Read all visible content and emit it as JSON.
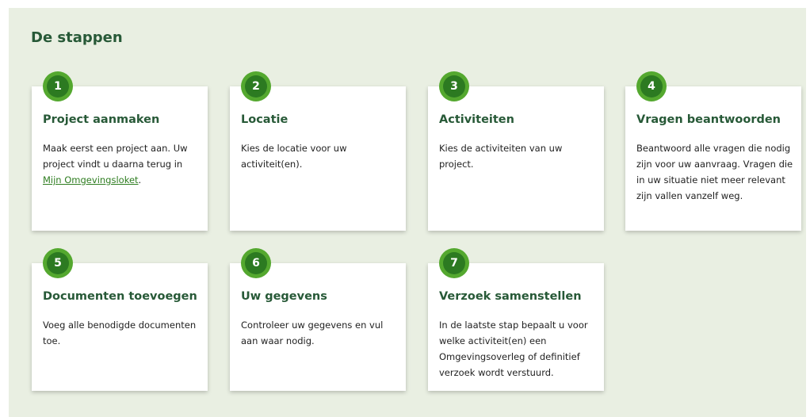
{
  "section": {
    "title": "De stappen"
  },
  "steps": [
    {
      "number": "1",
      "title": "Project aanmaken",
      "text_before": "Maak eerst een project aan. Uw project vindt u daarna terug in ",
      "link": "Mijn Omgevingsloket",
      "text_after": "."
    },
    {
      "number": "2",
      "title": "Locatie",
      "text": "Kies de locatie voor uw activiteit(en)."
    },
    {
      "number": "3",
      "title": "Activiteiten",
      "text": "Kies de activiteiten van uw project."
    },
    {
      "number": "4",
      "title": "Vragen beantwoorden",
      "text": "Beantwoord alle vragen die nodig zijn voor uw aanvraag. Vragen die in uw situatie niet meer relevant zijn vallen vanzelf weg."
    },
    {
      "number": "5",
      "title": "Documenten toevoegen",
      "text": "Voeg alle benodigde documenten toe."
    },
    {
      "number": "6",
      "title": "Uw gegevens",
      "text": "Controleer uw gegevens en vul aan waar nodig."
    },
    {
      "number": "7",
      "title": "Verzoek samenstellen",
      "text": "In de laatste stap bepaalt u voor welke activiteit(en) een Omgevingsoverleg of definitief verzoek wordt verstuurd."
    }
  ],
  "colors": {
    "panel_background": "#e9efe2",
    "title_green": "#275937",
    "badge_outer": "#54a82f",
    "badge_inner": "#2c7a21",
    "link_green": "#2e7d20"
  }
}
